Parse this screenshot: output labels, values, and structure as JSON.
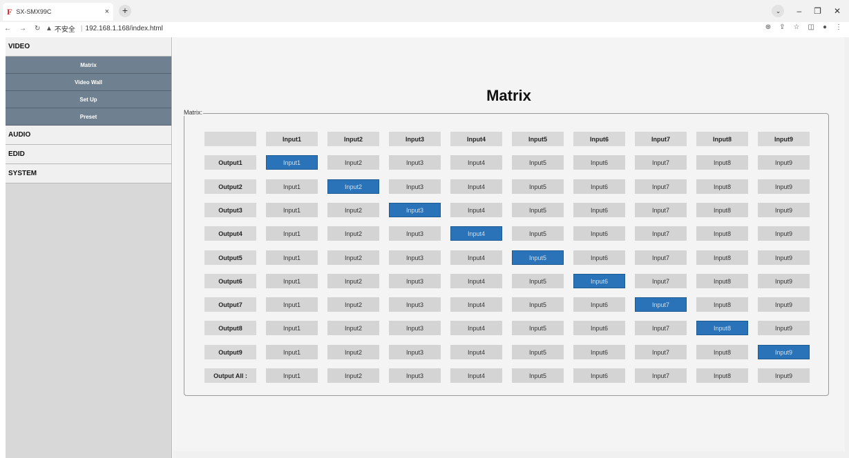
{
  "browser": {
    "tab_title": "SX-SMX99C",
    "tab_icon": "F",
    "close_glyph": "×",
    "new_tab_glyph": "+",
    "security_text": "不安全",
    "url": "192.168.1.168/index.html"
  },
  "sidebar": {
    "sections": [
      {
        "label": "VIDEO"
      },
      {
        "label": "AUDIO"
      },
      {
        "label": "EDID"
      },
      {
        "label": "SYSTEM"
      }
    ],
    "video_items": [
      {
        "label": "Matrix"
      },
      {
        "label": "Video Wall"
      },
      {
        "label": "Set Up"
      },
      {
        "label": "Preset"
      }
    ]
  },
  "main": {
    "title": "Matrix",
    "legend": "Matrix:",
    "header_inputs": [
      "Input1",
      "Input2",
      "Input3",
      "Input4",
      "Input5",
      "Input6",
      "Input7",
      "Input8",
      "Input9"
    ],
    "rows": [
      {
        "label": "Output1",
        "selected": 1
      },
      {
        "label": "Output2",
        "selected": 2
      },
      {
        "label": "Output3",
        "selected": 3
      },
      {
        "label": "Output4",
        "selected": 4
      },
      {
        "label": "Output5",
        "selected": 5
      },
      {
        "label": "Output6",
        "selected": 6
      },
      {
        "label": "Output7",
        "selected": 7
      },
      {
        "label": "Output8",
        "selected": 8
      },
      {
        "label": "Output9",
        "selected": 9
      },
      {
        "label": "Output All :",
        "selected": 0
      }
    ],
    "selected_color": "#2a73b8"
  }
}
